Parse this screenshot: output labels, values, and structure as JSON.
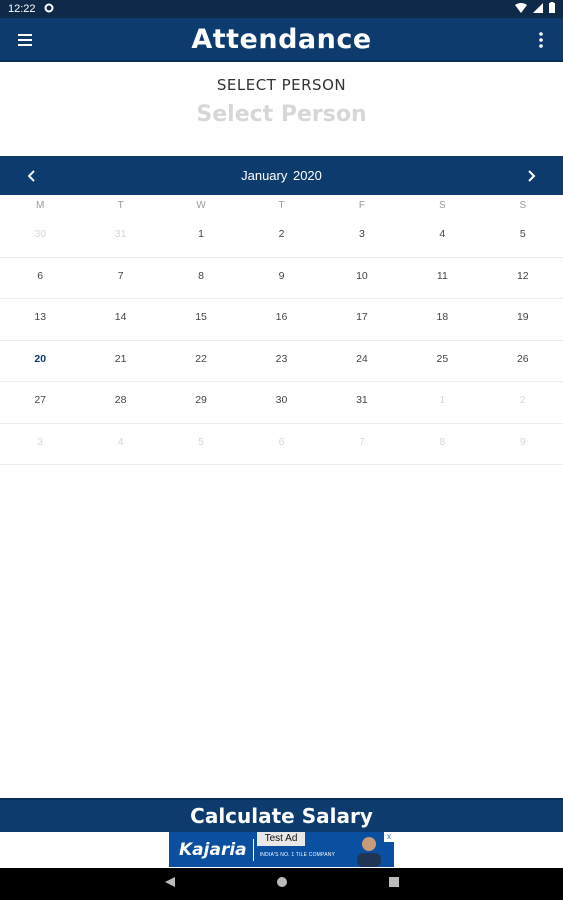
{
  "status_bar": {
    "time": "12:22"
  },
  "app_bar": {
    "title": "Attendance"
  },
  "select": {
    "label": "SELECT PERSON",
    "placeholder": "Select Person"
  },
  "calendar": {
    "month_title": "January  2020",
    "weekdays": [
      "M",
      "T",
      "W",
      "T",
      "F",
      "S",
      "S"
    ],
    "weeks": [
      [
        {
          "d": "30",
          "o": true
        },
        {
          "d": "31",
          "o": true
        },
        {
          "d": "1"
        },
        {
          "d": "2"
        },
        {
          "d": "3"
        },
        {
          "d": "4"
        },
        {
          "d": "5"
        }
      ],
      [
        {
          "d": "6"
        },
        {
          "d": "7"
        },
        {
          "d": "8"
        },
        {
          "d": "9"
        },
        {
          "d": "10"
        },
        {
          "d": "11"
        },
        {
          "d": "12"
        }
      ],
      [
        {
          "d": "13"
        },
        {
          "d": "14"
        },
        {
          "d": "15"
        },
        {
          "d": "16"
        },
        {
          "d": "17"
        },
        {
          "d": "18"
        },
        {
          "d": "19"
        }
      ],
      [
        {
          "d": "20",
          "today": true
        },
        {
          "d": "21"
        },
        {
          "d": "22"
        },
        {
          "d": "23"
        },
        {
          "d": "24"
        },
        {
          "d": "25"
        },
        {
          "d": "26"
        }
      ],
      [
        {
          "d": "27"
        },
        {
          "d": "28"
        },
        {
          "d": "29"
        },
        {
          "d": "30"
        },
        {
          "d": "31"
        },
        {
          "d": "1",
          "o": true
        },
        {
          "d": "2",
          "o": true
        }
      ],
      [
        {
          "d": "3",
          "o": true
        },
        {
          "d": "4",
          "o": true
        },
        {
          "d": "5",
          "o": true
        },
        {
          "d": "6",
          "o": true
        },
        {
          "d": "7",
          "o": true
        },
        {
          "d": "8",
          "o": true
        },
        {
          "d": "9",
          "o": true
        }
      ]
    ]
  },
  "calculate_button": {
    "label": "Calculate Salary"
  },
  "ad": {
    "test_label": "Test Ad",
    "brand": "Kajaria",
    "tagline": "INDIA'S NO. 1 TILE COMPANY"
  }
}
